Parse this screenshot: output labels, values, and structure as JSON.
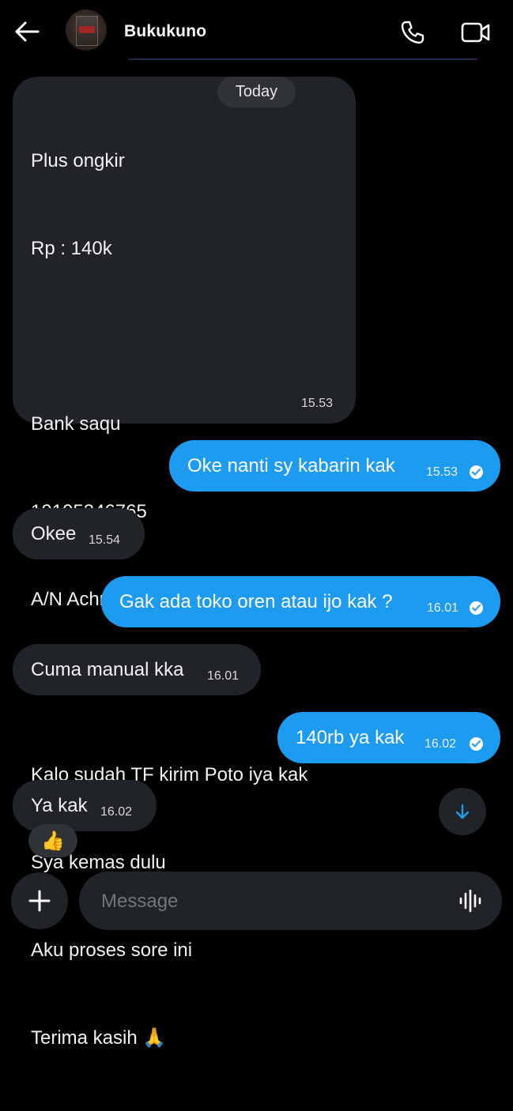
{
  "header": {
    "back_icon": "arrow-left-icon",
    "contact_name": "Bukukuno",
    "call_icon": "phone-icon",
    "video_icon": "video-camera-icon"
  },
  "date_separator": "Today",
  "messages": [
    {
      "direction": "incoming",
      "lines": [
        "Plus ongkir",
        "Rp : 140k",
        "",
        "Bank saqu",
        "10105346765",
        "A/N Achmad faizal",
        "",
        "Kalo sudah TF kirim Poto iya kak",
        "Sya kemas dulu",
        "Aku proses sore ini",
        "Terima kasih 🙏"
      ],
      "time": "15.53"
    },
    {
      "direction": "outgoing",
      "text": "Oke nanti sy kabarin kak",
      "time": "15.53",
      "status": "read"
    },
    {
      "direction": "incoming",
      "text": "Okee",
      "time": "15.54"
    },
    {
      "direction": "outgoing",
      "text": "Gak ada toko oren atau ijo kak ?",
      "time": "16.01",
      "status": "read"
    },
    {
      "direction": "incoming",
      "text": "Cuma manual kka",
      "time": "16.01"
    },
    {
      "direction": "outgoing",
      "text": "140rb ya kak",
      "time": "16.02",
      "status": "read"
    },
    {
      "direction": "incoming",
      "text": "Ya kak",
      "time": "16.02",
      "reaction": "👍"
    }
  ],
  "scroll_to_bottom_icon": "arrow-down-icon",
  "composer": {
    "add_icon": "plus-icon",
    "placeholder": "Message",
    "voice_icon": "waveform-icon"
  },
  "colors": {
    "background": "#000000",
    "incoming_bubble": "#202327",
    "outgoing_bubble": "#1d9bf0",
    "pill": "#2f3336"
  }
}
